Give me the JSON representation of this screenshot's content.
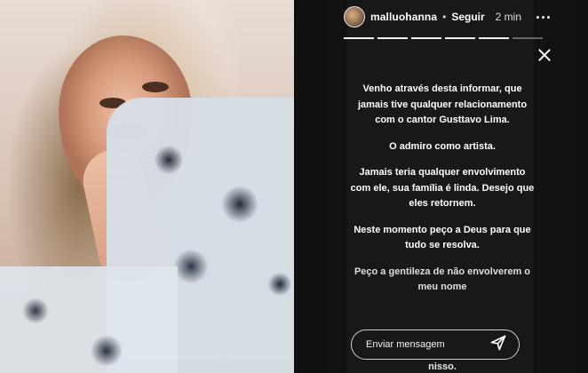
{
  "story": {
    "header": {
      "username": "malluohanna",
      "separator": "•",
      "follow_label": "Seguir",
      "time": "2 min",
      "more_icon": "more-horizontal-icon"
    },
    "close_icon": "close-icon",
    "progress": {
      "segments_total": 6,
      "segments_completed": 5
    },
    "message": {
      "p1": "Venho através desta informar, que jamais tive qualquer relacionamento com o cantor Gusttavo Lima.",
      "p2": "O admiro como artista.",
      "p3": "Jamais teria qualquer envolvimento com ele, sua família é linda. Desejo que eles retornem.",
      "p4": "Neste momento peço a Deus para que tudo se resolva.",
      "p5_partial": "Peço a gentileza de não envolverem o meu nome",
      "p5_last_word": "nisso."
    },
    "reply": {
      "placeholder": "Enviar mensagem",
      "send_icon": "send-icon"
    }
  }
}
